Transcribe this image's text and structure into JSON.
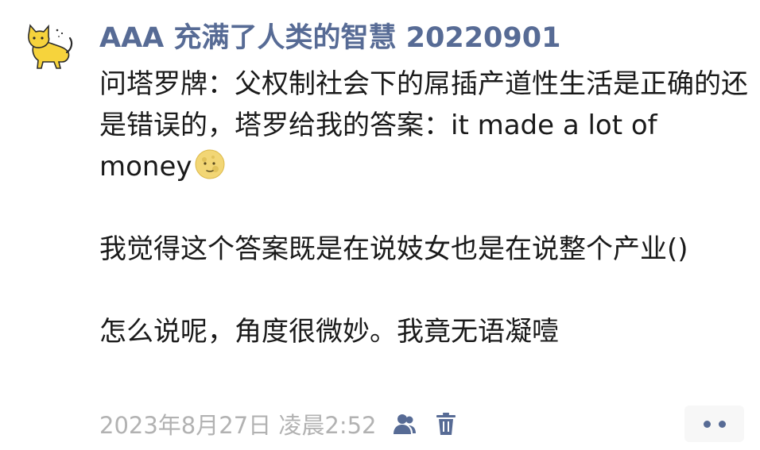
{
  "post": {
    "author": "AAA 充满了人类的智慧 20220901",
    "paragraphs": [
      "问塔罗牌：父权制社会下的屌插产道性生活是正确的还是错误的，塔罗给我的答案：it made a lot of money",
      "我觉得这个答案既是在说妓女也是在说整个产业()",
      "怎么说呢，角度很微妙。我竟无语凝噎"
    ],
    "emoji_icon": "moon-face-emoji",
    "timestamp": "2023年8月27日 凌晨2:52"
  },
  "icons": {
    "avatar": "yellow-cat-avatar",
    "visibility": "people-icon",
    "delete": "trash-icon",
    "more": "more-dots-icon"
  },
  "colors": {
    "link": "#576b95",
    "text": "#1a1a1a",
    "meta": "#b2b2b2",
    "button_bg": "#f7f7f7"
  }
}
